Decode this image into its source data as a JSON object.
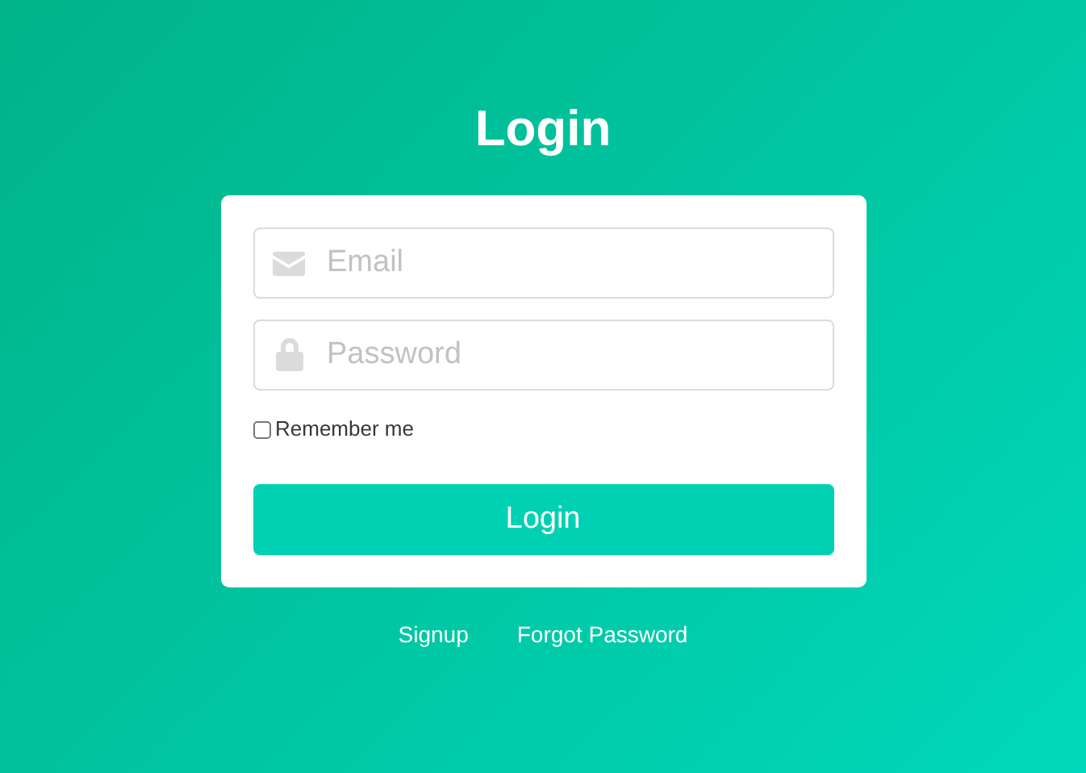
{
  "title": "Login",
  "form": {
    "email": {
      "placeholder": "Email"
    },
    "password": {
      "placeholder": "Password"
    },
    "remember": {
      "label": "Remember me",
      "checked": false
    },
    "submit": "Login"
  },
  "links": [
    {
      "label": "Signup"
    },
    {
      "label": "Forgot Password"
    }
  ]
}
